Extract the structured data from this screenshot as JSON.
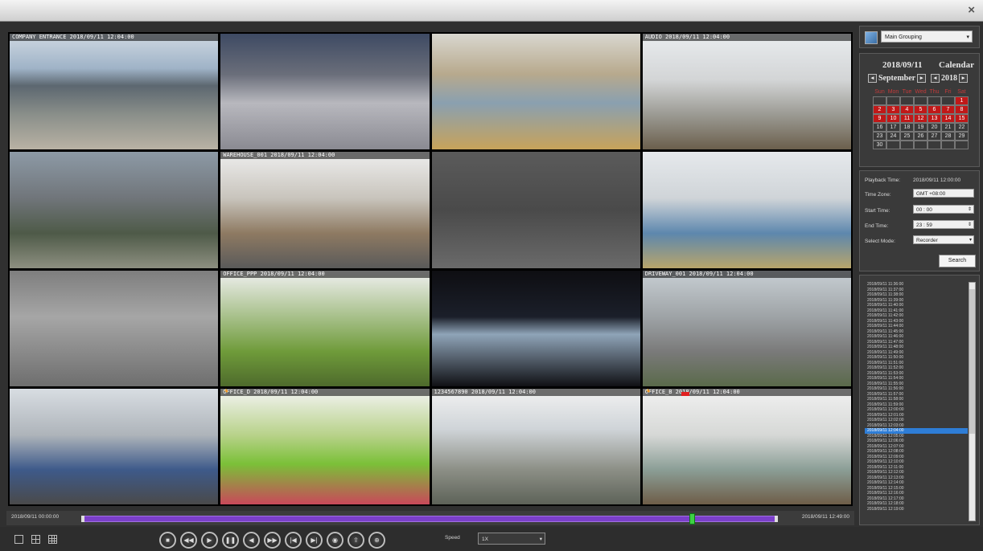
{
  "window": {
    "close_label": "×"
  },
  "cameras": [
    {
      "osd": "COMPANY ENTRANCE  2018/09/11  12:04:00",
      "bg": "linear-gradient(#cfd8e2 0%,#9fb3c7 30%,#5c6770 45%,#8a8f8a 70%,#b9b2a4 100%)"
    },
    {
      "osd": "",
      "bg": "linear-gradient(#3e4a63 0%,#6a6e7a 35%,#b8b8be 60%,#8a8a92 100%)"
    },
    {
      "osd": "",
      "bg": "linear-gradient(#d9d7cf 0%,#b7a98d 35%,#8aa0b0 60%,#c8a35a 100%)"
    },
    {
      "osd": "AUDIO  2018/09/11  12:04:00",
      "bg": "linear-gradient(#e9ecef 0%,#d3d5d6 40%,#9b9a93 70%,#6b5f4c 100%)"
    },
    {
      "osd": "",
      "bg": "linear-gradient(#8d9aa6 0%,#70757a 40%,#4e5a48 70%,#8d8f80 100%)"
    },
    {
      "osd": "WAREHOUSE_001  2018/09/11  12:04:00",
      "bg": "linear-gradient(#eeeeee 0%,#c8c4bc 40%,#8e7a62 70%,#5a5a5a 100%)"
    },
    {
      "osd": "",
      "bg": "linear-gradient(#5b5b5b 0%,#4a4a4a 50%,#6a6a6a 100%)"
    },
    {
      "osd": "",
      "bg": "linear-gradient(#e6e9ec 0%,#cfd4d8 40%,#5d87ad 70%,#b8a56b 100%)"
    },
    {
      "osd": "",
      "bg": "linear-gradient(#7e7e7e 0%,#a6a6a6 40%,#6e6e6e 100%)"
    },
    {
      "osd": "OFFICE_PPP  2018/09/11  12:04:00",
      "bg": "linear-gradient(#f0f0f0 0%,#a7c08a 40%,#6f9b3a 70%,#4e6a2c 100%)"
    },
    {
      "osd": "",
      "bg": "linear-gradient(#0e0e12 0%,#1b1f2a 40%,#8fa4b8 55%,#101014 100%)"
    },
    {
      "osd": "DRIVEWAY_001  2018/09/11  12:04:00",
      "bg": "linear-gradient(#c8cfd4 0%,#9ea3a6 40%,#7a7a7a 70%,#5a6a4a 100%)"
    },
    {
      "osd": "",
      "bg": "linear-gradient(#d8dde2 0%,#aeb4ba 40%,#3e5a8a 70%,#4a4a4a 100%)"
    },
    {
      "osd": "OFFICE_D  2018/09/11  12:04:00",
      "bg": "linear-gradient(#f4f4f4 0%,#b8d28a 40%,#7bc038 65%,#c9485a 100%)",
      "runner": true
    },
    {
      "osd": "1234567890  2018/09/11  12:04:00",
      "bg": "linear-gradient(#f2f2f2 0%,#cfd4d8 35%,#8c8f86 70%,#5d6258 100%)"
    },
    {
      "osd": "OFFICE_B  2018/09/11  12:04:00",
      "bg": "linear-gradient(#f1f1f1 0%,#d6d8d6 40%,#8b9e96 70%,#6e5d48 100%)",
      "runner": true,
      "redtag": true
    }
  ],
  "group": {
    "selected": "Main Grouping"
  },
  "calendar": {
    "date": "2018/09/11",
    "title": "Calendar",
    "month": "September",
    "year": "2018",
    "weekdays": [
      "Sun",
      "Mon",
      "Tue",
      "Wed",
      "Thu",
      "Fri",
      "Sat"
    ],
    "weeks": [
      [
        "",
        "",
        "",
        "",
        "",
        "",
        "1"
      ],
      [
        "2",
        "3",
        "4",
        "5",
        "6",
        "7",
        "8"
      ],
      [
        "9",
        "10",
        "11",
        "12",
        "13",
        "14",
        "15"
      ],
      [
        "16",
        "17",
        "18",
        "19",
        "20",
        "21",
        "22"
      ],
      [
        "23",
        "24",
        "25",
        "26",
        "27",
        "28",
        "29"
      ],
      [
        "30",
        "",
        "",
        "",
        "",
        "",
        ""
      ]
    ],
    "recorded_days": [
      "1",
      "2",
      "3",
      "4",
      "5",
      "6",
      "7",
      "8",
      "9",
      "10",
      "11",
      "12",
      "13",
      "14",
      "15"
    ]
  },
  "search": {
    "playback_label": "Playback Time:",
    "playback_value": "2018/09/11 12:00:00",
    "timezone_label": "Time Zone:",
    "timezone_value": "GMT +08:00",
    "start_label": "Start Time:",
    "start_value": "00 : 00",
    "end_label": "End Time:",
    "end_value": "23 : 59",
    "mode_label": "Select Mode:",
    "mode_value": "Recorder",
    "button": "Search"
  },
  "records": [
    "2018/09/11 11:36:00",
    "2018/09/11 11:37:00",
    "2018/09/11 11:38:00",
    "2018/09/11 11:39:00",
    "2018/09/11 11:40:00",
    "2018/09/11 11:41:00",
    "2018/09/11 11:42:00",
    "2018/09/11 11:43:00",
    "2018/09/11 11:44:00",
    "2018/09/11 11:45:00",
    "2018/09/11 11:46:00",
    "2018/09/11 11:47:00",
    "2018/09/11 11:48:00",
    "2018/09/11 11:49:00",
    "2018/09/11 11:50:00",
    "2018/09/11 11:51:00",
    "2018/09/11 11:52:00",
    "2018/09/11 11:53:00",
    "2018/09/11 11:54:00",
    "2018/09/11 11:55:00",
    "2018/09/11 11:56:00",
    "2018/09/11 11:57:00",
    "2018/09/11 11:58:00",
    "2018/09/11 11:59:00",
    "2018/09/11 12:00:00",
    "2018/09/11 12:01:00",
    "2018/09/11 12:02:00",
    "2018/09/11 12:03:00",
    "2018/09/11 12:04:00",
    "2018/09/11 12:05:00",
    "2018/09/11 12:06:00",
    "2018/09/11 12:07:00",
    "2018/09/11 12:08:00",
    "2018/09/11 12:09:00",
    "2018/09/11 12:10:00",
    "2018/09/11 12:11:00",
    "2018/09/11 12:12:00",
    "2018/09/11 12:13:00",
    "2018/09/11 12:14:00",
    "2018/09/11 12:15:00",
    "2018/09/11 12:16:00",
    "2018/09/11 12:17:00",
    "2018/09/11 12:18:00",
    "2018/09/11 12:19:00"
  ],
  "records_selected": "2018/09/11 12:04:00",
  "timeline": {
    "start": "2018/09/11 00:00:00",
    "end": "2018/09/11 12:49:00",
    "position_fraction": 0.875
  },
  "controls": {
    "buttons": [
      "stop",
      "rewind",
      "play",
      "pause",
      "slow",
      "fast",
      "frame-back",
      "frame-forward",
      "snapshot",
      "export",
      "zoom"
    ]
  },
  "speed": {
    "label": "Speed",
    "value": "1X"
  },
  "colors": {
    "timeline": "#7b3fc9",
    "record_selected": "#2e7dd6",
    "calendar_record": "#c01818"
  }
}
